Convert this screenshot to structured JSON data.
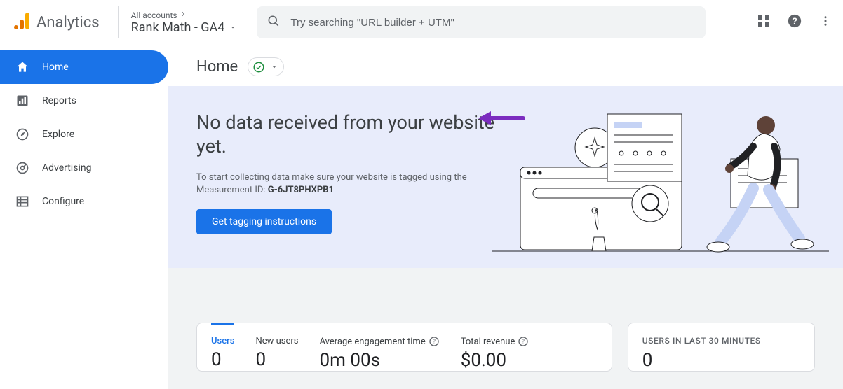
{
  "header": {
    "product": "Analytics",
    "account_top": "All accounts",
    "account_name": "Rank Math - GA4",
    "search_placeholder": "Try searching \"URL builder + UTM\""
  },
  "sidebar": {
    "items": [
      {
        "label": "Home"
      },
      {
        "label": "Reports"
      },
      {
        "label": "Explore"
      },
      {
        "label": "Advertising"
      },
      {
        "label": "Configure"
      }
    ]
  },
  "page": {
    "title": "Home"
  },
  "hero": {
    "title": "No data received from your website yet.",
    "sub_prefix": "To start collecting data make sure your website is tagged using the Measurement ID: ",
    "measurement_id": "G-6JT8PHXPB1",
    "button": "Get tagging instructions"
  },
  "metrics": [
    {
      "label": "Users",
      "value": "0"
    },
    {
      "label": "New users",
      "value": "0"
    },
    {
      "label": "Average engagement time",
      "value": "0m 00s"
    },
    {
      "label": "Total revenue",
      "value": "$0.00"
    }
  ],
  "realtime": {
    "title": "USERS IN LAST 30 MINUTES",
    "value": "0"
  }
}
